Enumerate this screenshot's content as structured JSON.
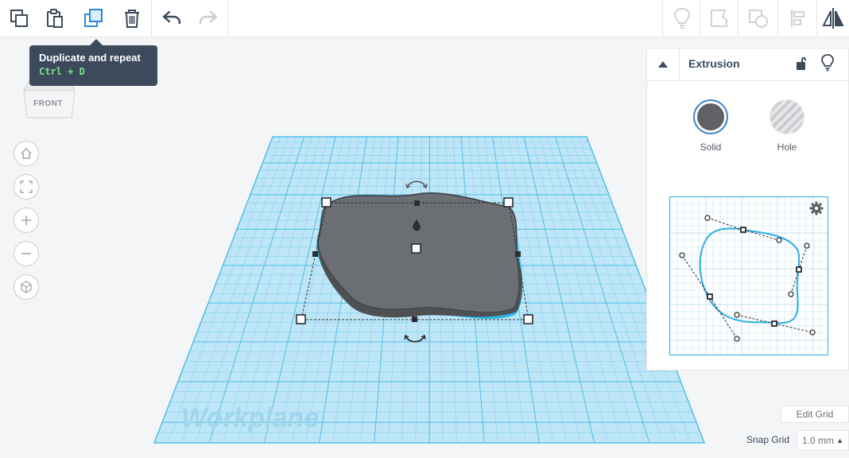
{
  "toolbar": {
    "left_tools": [
      {
        "icon": "copy-icon"
      },
      {
        "icon": "paste-icon"
      },
      {
        "icon": "duplicate-icon",
        "active": true
      },
      {
        "icon": "trash-icon"
      }
    ],
    "history_tools": [
      {
        "icon": "undo-icon"
      },
      {
        "icon": "redo-icon",
        "disabled": true
      }
    ],
    "right_tools": [
      {
        "icon": "lightbulb-icon",
        "disabled": true
      },
      {
        "icon": "group-icon",
        "disabled": true
      },
      {
        "icon": "ungroup-icon",
        "disabled": true
      },
      {
        "icon": "align-icon",
        "disabled": true
      },
      {
        "icon": "mirror-icon"
      }
    ]
  },
  "tooltip": {
    "title": "Duplicate and repeat",
    "shortcut": "Ctrl + D"
  },
  "viewcube": {
    "face_label": "FRONT"
  },
  "nav_controls": [
    {
      "icon": "home-icon"
    },
    {
      "icon": "fit-view-icon"
    },
    {
      "icon": "zoom-in-icon"
    },
    {
      "icon": "zoom-out-icon"
    },
    {
      "icon": "perspective-icon"
    }
  ],
  "workplane": {
    "label": "Workplane",
    "grid_color": "#3fb7e6"
  },
  "shape": {
    "fill": "#6b6e72",
    "outline": "#29b6e8"
  },
  "panel": {
    "title": "Extrusion",
    "options": {
      "solid_label": "Solid",
      "hole_label": "Hole"
    },
    "colors": {
      "solid": "#5f6165",
      "selected_ring": "#3b83c6",
      "curve": "#2aaee4"
    }
  },
  "bottom": {
    "edit_grid_label": "Edit Grid",
    "snap_grid_label": "Snap Grid",
    "snap_grid_value": "1.0 mm"
  }
}
